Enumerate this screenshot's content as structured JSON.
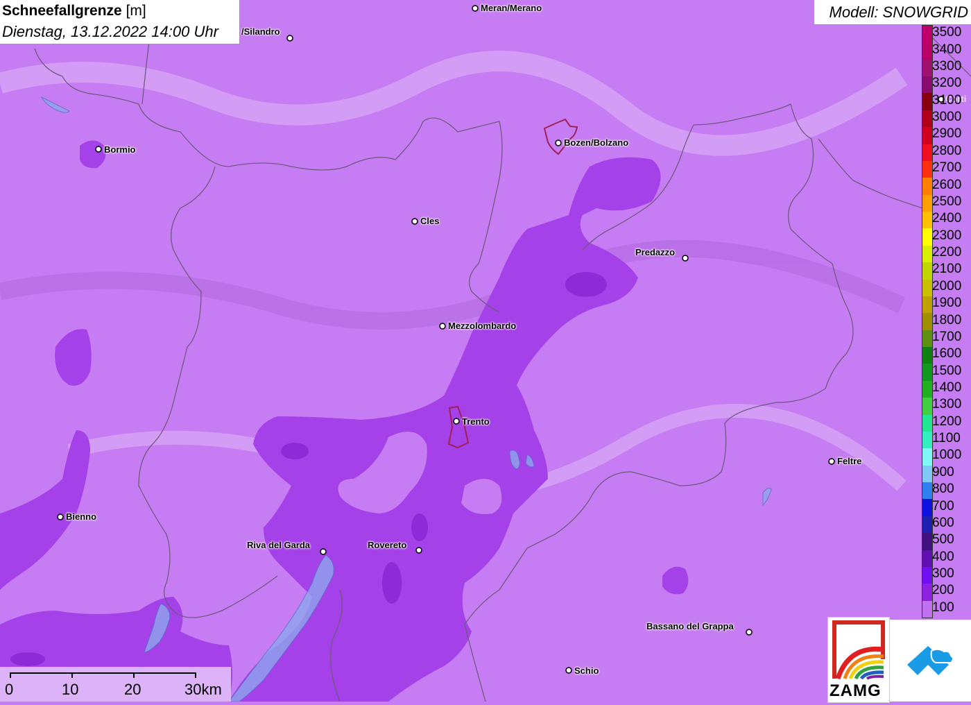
{
  "title": {
    "bold": "Schneefallgrenze",
    "unit": "[m]",
    "datetime": "Dienstag, 13.12.2022 14:00 Uhr"
  },
  "model": "Modell: SNOWGRID",
  "colors": {
    "background": "#c67cf2",
    "mid_band": "#a13ee6",
    "low_band": "#8a1de0",
    "border_line": "#7a5a90"
  },
  "legend": [
    {
      "label": "3500",
      "color": "#c0006a"
    },
    {
      "label": "3400",
      "color": "#b80068"
    },
    {
      "label": "3300",
      "color": "#a0106e"
    },
    {
      "label": "3200",
      "color": "#880c6e"
    },
    {
      "label": "3100",
      "color": "#880010"
    },
    {
      "label": "3000",
      "color": "#b0001a"
    },
    {
      "label": "2900",
      "color": "#d00020"
    },
    {
      "label": "2800",
      "color": "#ee1020"
    },
    {
      "label": "2700",
      "color": "#ff3010"
    },
    {
      "label": "2600",
      "color": "#ff8000"
    },
    {
      "label": "2500",
      "color": "#ffa000"
    },
    {
      "label": "2400",
      "color": "#ffc000"
    },
    {
      "label": "2300",
      "color": "#ffff00"
    },
    {
      "label": "2200",
      "color": "#d8f000"
    },
    {
      "label": "2100",
      "color": "#c0d800"
    },
    {
      "label": "2000",
      "color": "#c8c000"
    },
    {
      "label": "1900",
      "color": "#c0a000"
    },
    {
      "label": "1800",
      "color": "#a09000"
    },
    {
      "label": "1700",
      "color": "#609010"
    },
    {
      "label": "1600",
      "color": "#108010"
    },
    {
      "label": "1500",
      "color": "#109820"
    },
    {
      "label": "1400",
      "color": "#20b020"
    },
    {
      "label": "1300",
      "color": "#40d040"
    },
    {
      "label": "1200",
      "color": "#20e890"
    },
    {
      "label": "1100",
      "color": "#30f0c0"
    },
    {
      "label": "1000",
      "color": "#80f8f8"
    },
    {
      "label": "900",
      "color": "#80c8f8"
    },
    {
      "label": "800",
      "color": "#3080f0"
    },
    {
      "label": "700",
      "color": "#1010e0"
    },
    {
      "label": "600",
      "color": "#2020b0"
    },
    {
      "label": "500",
      "color": "#401080"
    },
    {
      "label": "400",
      "color": "#6010b0"
    },
    {
      "label": "300",
      "color": "#7010f0"
    },
    {
      "label": "200",
      "color": "#9020e0"
    },
    {
      "label": "100",
      "color": "#c070f0"
    }
  ],
  "cities": [
    {
      "name": "Meran/Merano",
      "label_id": "meran"
    },
    {
      "name": "/Silandro",
      "label_id": "silandro"
    },
    {
      "name": "Bormio",
      "label_id": "bormio"
    },
    {
      "name": "Bozen/Bolzano",
      "label_id": "bozen"
    },
    {
      "name": "Cles",
      "label_id": "cles"
    },
    {
      "name": "Predazzo",
      "label_id": "predazzo"
    },
    {
      "name": "Mezzolombardo",
      "label_id": "mezzolombardo"
    },
    {
      "name": "Trento",
      "label_id": "trento"
    },
    {
      "name": "Feltre",
      "label_id": "feltre"
    },
    {
      "name": "Bienno",
      "label_id": "bienno"
    },
    {
      "name": "Riva del Garda",
      "label_id": "riva"
    },
    {
      "name": "Rovereto",
      "label_id": "rovereto"
    },
    {
      "name": "Bassano del Grappa",
      "label_id": "bassano"
    },
    {
      "name": "Schio",
      "label_id": "schio"
    },
    {
      "name": "Corti",
      "label_id": "corti"
    }
  ],
  "scale_bar": {
    "labels": [
      "0",
      "10",
      "20",
      "30km"
    ]
  },
  "logo_zamg": "ZAMG"
}
